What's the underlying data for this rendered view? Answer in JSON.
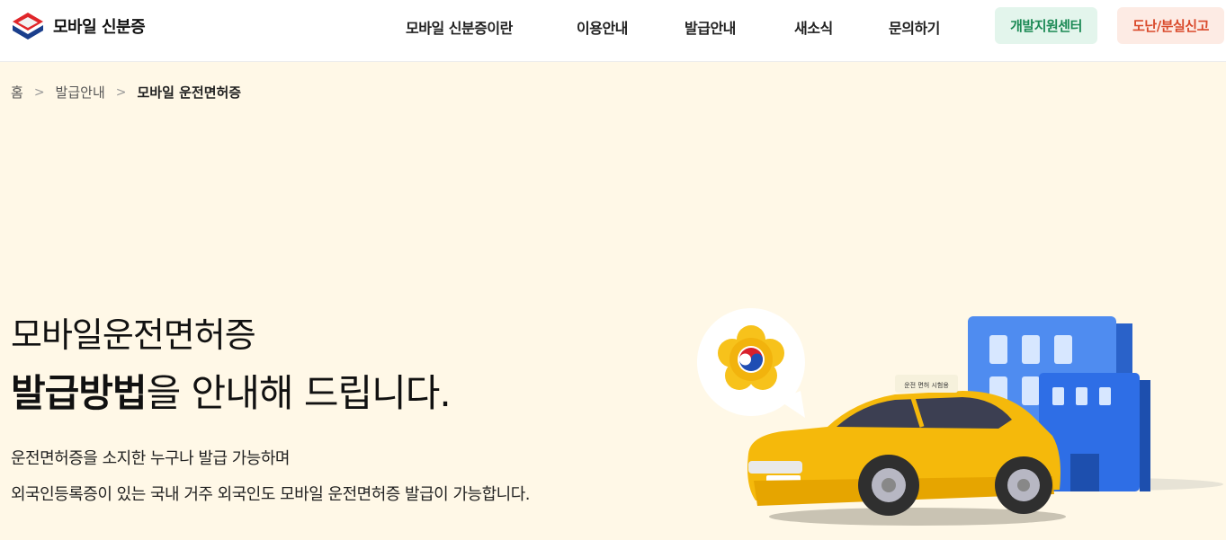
{
  "header": {
    "logo_text": "모바일 신분증",
    "nav": [
      "모바일 신분증이란",
      "이용안내",
      "발급안내",
      "새소식",
      "문의하기"
    ],
    "dev_center_label": "개발지원센터",
    "lost_report_label": "도난/분실신고"
  },
  "breadcrumb": {
    "home": "홈",
    "level1": "발급안내",
    "current": "모바일 운전면허증",
    "separator": ">"
  },
  "hero": {
    "line1": "모바일운전면허증",
    "line2_bold": "발급방법",
    "line2_rest": "을 안내해 드립니다.",
    "desc1": "운전면허증을 소지한 누구나 발급 가능하며",
    "desc2": "외국인등록증이 있는 국내 거주 외국인도 모바일 운전면허증 발급이 가능합니다."
  },
  "illustration": {
    "taxi_sign_text": "운전 면허 시험용",
    "emblem": "korea-government-emblem-icon"
  },
  "colors": {
    "background": "#fff8e7",
    "dev_button_bg": "#e3f5ec",
    "dev_button_text": "#1c8a55",
    "lost_button_bg": "#fdebe4",
    "lost_button_text": "#d94a2b",
    "taxi_yellow": "#f5b90b",
    "building_blue": "#2e6ee6"
  }
}
